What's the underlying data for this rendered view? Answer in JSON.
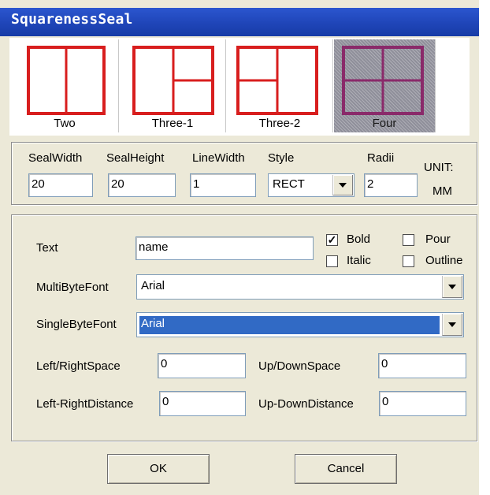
{
  "window": {
    "title": "SquarenessSeal"
  },
  "layouts": [
    {
      "label": "Two",
      "selected": false
    },
    {
      "label": "Three-1",
      "selected": false
    },
    {
      "label": "Three-2",
      "selected": false
    },
    {
      "label": "Four",
      "selected": true
    }
  ],
  "params": {
    "seal_width": {
      "label": "SealWidth",
      "value": "20"
    },
    "seal_height": {
      "label": "SealHeight",
      "value": "20"
    },
    "line_width": {
      "label": "LineWidth",
      "value": "1"
    },
    "style": {
      "label": "Style",
      "value": "RECT"
    },
    "radii": {
      "label": "Radii",
      "value": "2"
    },
    "unit_label": "UNIT:",
    "unit_value": "MM"
  },
  "text_group": {
    "text_label": "Text",
    "text_value": "name",
    "bold": {
      "label": "Bold",
      "checked": true
    },
    "pour": {
      "label": "Pour",
      "checked": false
    },
    "italic": {
      "label": "Italic",
      "checked": false
    },
    "outline": {
      "label": "Outline",
      "checked": false
    },
    "multibyte_label": "MultiByteFont",
    "multibyte_value": "Arial",
    "singlebyte_label": "SingleByteFont",
    "singlebyte_value": "Arial",
    "lr_space_label": "Left/RightSpace",
    "lr_space_value": "0",
    "ud_space_label": "Up/DownSpace",
    "ud_space_value": "0",
    "lr_distance_label": "Left-RightDistance",
    "lr_distance_value": "0",
    "ud_distance_label": "Up-DownDistance",
    "ud_distance_value": "0"
  },
  "buttons": {
    "ok": "OK",
    "cancel": "Cancel"
  },
  "colors": {
    "title_bar": "#2050c0",
    "seal_red": "#d81e1e",
    "seal_selected": "#8a2a6a",
    "selection": "#316ac5"
  }
}
